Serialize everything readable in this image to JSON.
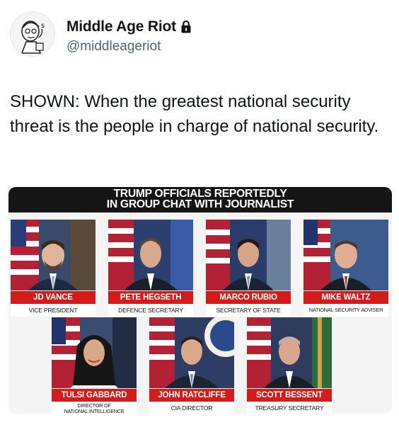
{
  "author": {
    "display_name": "Middle Age Riot",
    "handle": "@middleageriot",
    "avatar_icon": "cartoon-man-avatar",
    "protected_icon": "lock-icon"
  },
  "tweet": {
    "text": "SHOWN: When the greatest national security threat is the people in charge of national security."
  },
  "card": {
    "banner_line1": "TRUMP OFFICIALS REPORTEDLY",
    "banner_line2": "IN GROUP CHAT WITH JOURNALIST",
    "name_bar_color": "#d51a1a",
    "officials": [
      {
        "name": "JD VANCE",
        "title": "VICE PRESIDENT"
      },
      {
        "name": "PETE HEGSETH",
        "title": "DEFENCE SECRETARY"
      },
      {
        "name": "MARCO RUBIO",
        "title": "SECRETARY OF STATE"
      },
      {
        "name": "MIKE WALTZ",
        "title": "NATIONAL SECURITY ADVISER"
      },
      {
        "name": "TULSI GABBARD",
        "title": "DIRECTOR OF\nNATIONAL INTELLIGENCE"
      },
      {
        "name": "JOHN RATCLIFFE",
        "title": "CIA DIRECTOR"
      },
      {
        "name": "SCOTT BESSENT",
        "title": "TREASURY SECRETARY"
      }
    ]
  }
}
